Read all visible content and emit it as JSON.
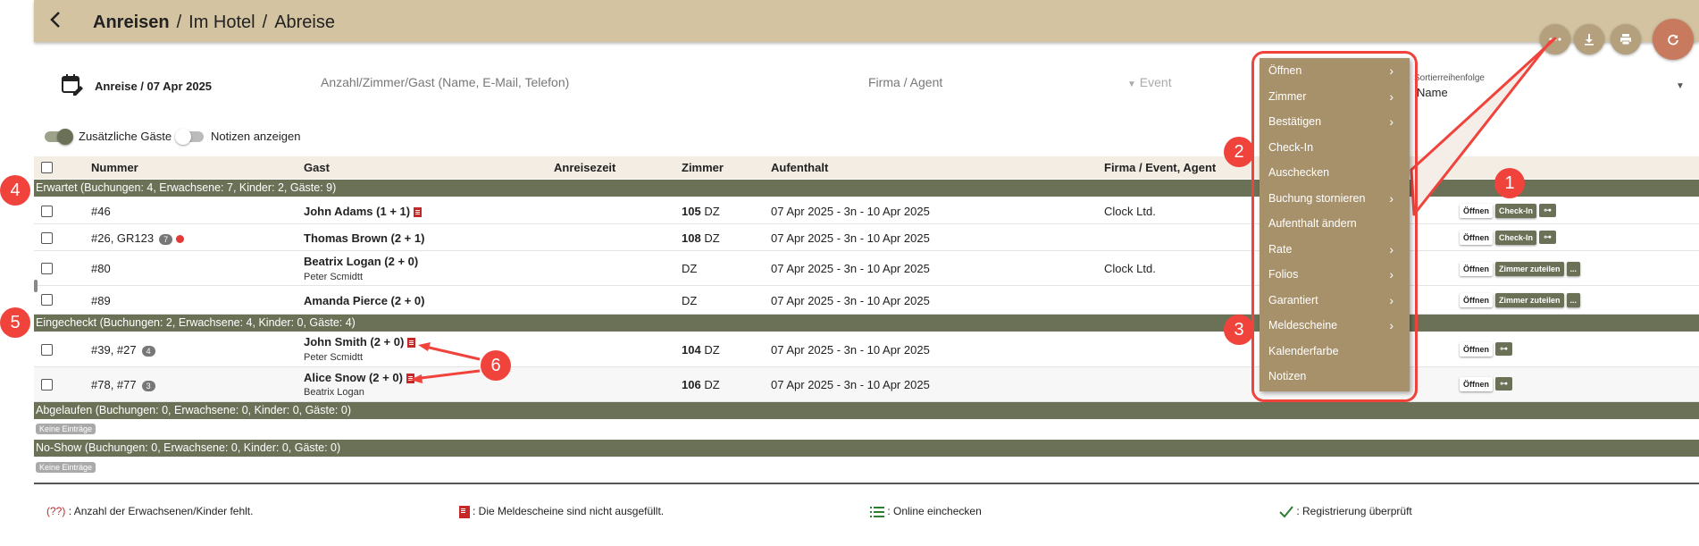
{
  "breadcrumb": {
    "main": "Anreisen",
    "sep": "/",
    "crumb2": "Im Hotel",
    "crumb3": "Abreise"
  },
  "filters": {
    "date_label": "Anreise / 07 Apr 2025",
    "search_placeholder": "Anzahl/Zimmer/Gast (Name, E-Mail, Telefon)",
    "company_placeholder": "Firma / Agent",
    "event_placeholder": "Event",
    "sort_label": "Sortierreihenfolge",
    "sort_value": "Name"
  },
  "toggles": {
    "extra_guests": "Zusätzliche Gäste",
    "show_notes": "Notizen anzeigen"
  },
  "columns": {
    "number": "Nummer",
    "guest": "Gast",
    "arrival_time": "Anreisezeit",
    "room": "Zimmer",
    "stay": "Aufenthalt",
    "company": "Firma / Event, Agent"
  },
  "groups": {
    "expected": "Erwartet (Buchungen: 4, Erwachsene: 7, Kinder: 2, Gäste: 9)",
    "checked_in": "Eingecheckt (Buchungen: 2, Erwachsene: 4, Kinder: 0, Gäste: 4)",
    "expired": "Abgelaufen (Buchungen: 0, Erwachsene: 0, Kinder: 0, Gäste: 0)",
    "noshow": "No-Show (Buchungen: 0, Erwachsene: 0, Kinder: 0, Gäste: 0)"
  },
  "empty_label": "Keine Einträge",
  "rows": [
    {
      "number": "#46",
      "guest": "John Adams (1 + 1)",
      "room_no": "105",
      "room_type": "DZ",
      "stay": "07 Apr 2025 - 3n - 10 Apr 2025",
      "company": "Clock Ltd."
    },
    {
      "number": "#26, GR123",
      "pill": "7",
      "guest": "Thomas Brown (2 + 1)",
      "room_no": "108",
      "room_type": "DZ",
      "stay": "07 Apr 2025 - 3n - 10 Apr 2025",
      "company": ""
    },
    {
      "number": "#80",
      "guest": "Beatrix Logan (2 + 0)",
      "sub": "Peter Scmidtt",
      "room_no": "",
      "room_type": "DZ",
      "stay": "07 Apr 2025 - 3n - 10 Apr 2025",
      "company": "Clock Ltd."
    },
    {
      "number": "#89",
      "guest": "Amanda Pierce (2 + 0)",
      "room_no": "",
      "room_type": "DZ",
      "stay": "07 Apr 2025 - 3n - 10 Apr 2025",
      "company": ""
    },
    {
      "number": "#39, #27",
      "pill": "4",
      "guest": "John Smith (2 + 0)",
      "sub": "Peter Scmidtt",
      "room_no": "104",
      "room_type": "DZ",
      "stay": "07 Apr 2025 - 3n - 10 Apr 2025",
      "company": ""
    },
    {
      "number": "#78, #77",
      "pill": "3",
      "guest": "Alice Snow (2 + 0)",
      "sub": "Beatrix Logan",
      "room_no": "106",
      "room_type": "DZ",
      "stay": "07 Apr 2025 - 3n - 10 Apr 2025",
      "company": ""
    }
  ],
  "actions": {
    "open": "Öffnen",
    "checkin": "Check-In",
    "assign_room": "Zimmer zuteilen",
    "more": "..."
  },
  "menu": [
    {
      "label": "Öffnen",
      "arrow": "›"
    },
    {
      "label": "Zimmer",
      "arrow": "›"
    },
    {
      "label": "Bestätigen",
      "arrow": "›"
    },
    {
      "label": "Check-In",
      "arrow": ""
    },
    {
      "label": "Auschecken",
      "arrow": ""
    },
    {
      "label": "Buchung stornieren",
      "arrow": "›"
    },
    {
      "label": "Aufenthalt ändern",
      "arrow": ""
    },
    {
      "label": "Rate",
      "arrow": "›"
    },
    {
      "label": "Folios",
      "arrow": "›"
    },
    {
      "label": "Garantiert",
      "arrow": "›"
    },
    {
      "label": "Meldescheine",
      "arrow": "›"
    },
    {
      "label": "Kalenderfarbe",
      "arrow": ""
    },
    {
      "label": "Notizen",
      "arrow": ""
    }
  ],
  "legend": {
    "l1_code": "(??)",
    "l1_text": ": Anzahl der Erwachsenen/Kinder fehlt.",
    "l2_text": ": Die Meldescheine sind nicht ausgefüllt.",
    "l3_text": ": Online einchecken",
    "l4_text": ": Registrierung überprüft"
  },
  "badges": [
    "1",
    "2",
    "3",
    "4",
    "5",
    "6"
  ],
  "colors": {
    "topbar": "#d3c3a1",
    "group": "#6a7157",
    "menu": "#a7916b",
    "callout": "#f0433c",
    "refresh": "#c87a5e"
  }
}
